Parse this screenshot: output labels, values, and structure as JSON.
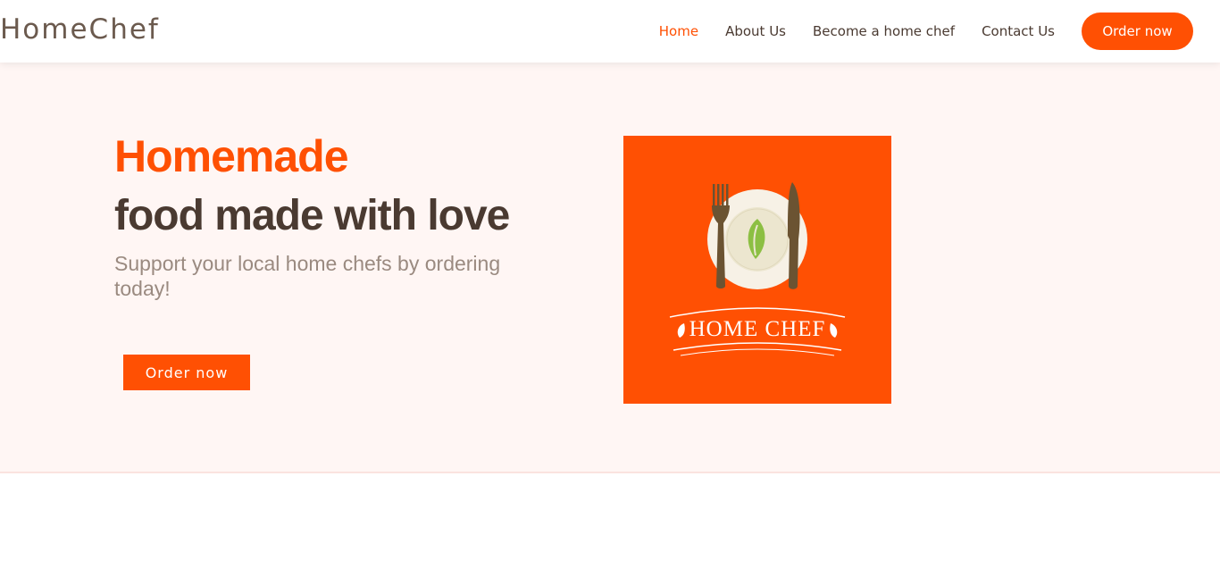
{
  "brand": {
    "name": "HomeChef"
  },
  "nav": {
    "links": [
      {
        "label": "Home",
        "active": true
      },
      {
        "label": "About Us",
        "active": false
      },
      {
        "label": "Become a home chef",
        "active": false
      },
      {
        "label": "Contact Us",
        "active": false
      }
    ],
    "order_button": "Order now"
  },
  "hero": {
    "title": "Homemade",
    "subtitle": "food made with love",
    "tagline": "Support your local home chefs by ordering today!",
    "order_button": "Order now",
    "logo_text": "HOME CHEF"
  },
  "colors": {
    "accent": "#ff5003",
    "dark_text": "#4a3a31",
    "muted_text": "#9a8a80",
    "hero_bg": "#fff6f4"
  }
}
